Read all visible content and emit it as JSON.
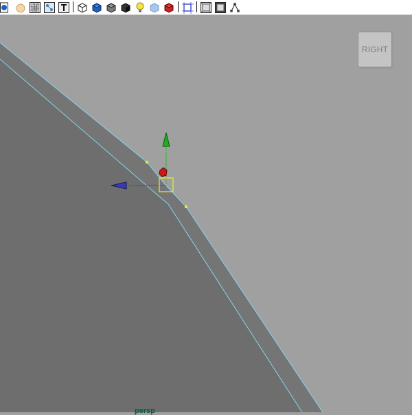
{
  "toolbar": {
    "buttons": [
      {
        "name": "select-camera-icon",
        "fill": "#1f5fbf"
      },
      {
        "name": "lock-camera-icon",
        "fill": "#f3d7a8"
      },
      {
        "name": "image-plane-icon",
        "fill": "#cfcfcf"
      },
      {
        "name": "2d-pan-zoom-icon",
        "fill": "#4a7dbf"
      },
      {
        "name": "grease-pencil-icon",
        "fill": "#dddddd"
      },
      {
        "name": "wireframe-icon",
        "fill": "#ffffff"
      },
      {
        "name": "smooth-shade-all-icon",
        "fill": "#1f5fbf"
      },
      {
        "name": "use-default-material-icon",
        "fill": "#7a7a7a"
      },
      {
        "name": "shadows-icon",
        "fill": "#333333"
      },
      {
        "name": "use-all-lights-icon",
        "fill": "#f2e24b"
      },
      {
        "name": "xray-icon",
        "fill": "#9cc2ea"
      },
      {
        "name": "xray-joints-icon",
        "fill": "#cc2222"
      },
      {
        "name": "isolate-select-icon",
        "fill": "#4455cc"
      },
      {
        "name": "resolution-gate-icon",
        "fill": "#555555"
      },
      {
        "name": "gate-mask-icon",
        "fill": "#555555"
      }
    ]
  },
  "viewcube": {
    "label": "RIGHT"
  },
  "viewport": {
    "camera_label": "persp"
  },
  "colors": {
    "viewport_bg": "#a0a0a0",
    "surface_dark": "#6e6e6e",
    "edge_highlight": "#7fd8ec",
    "vertex": "#e8ef2a",
    "manipulator_y": "#1fae1f",
    "manipulator_z": "#3a3ab0",
    "manipulator_center": "#cc1a1a"
  }
}
